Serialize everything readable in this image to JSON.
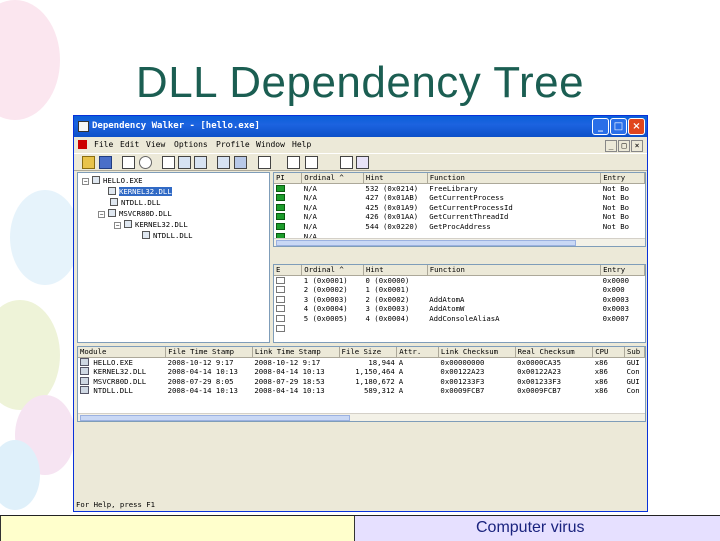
{
  "slide": {
    "title": "DLL Dependency Tree",
    "footer": "Computer virus"
  },
  "window": {
    "title": "Dependency Walker - [hello.exe]",
    "controls": {
      "minimize": "_",
      "maximize": "□",
      "close": "×"
    },
    "mdi_controls": [
      "_",
      "□",
      "×"
    ],
    "menu": [
      "File",
      "Edit",
      "View",
      "Options",
      "Profile",
      "Window",
      "Help"
    ]
  },
  "toolbar": {
    "icons": [
      "open-icon",
      "save-icon",
      "copy-icon",
      "find-icon",
      "full-paths-icon",
      "undecorate-icon",
      "configure-icon",
      "view-module-icon",
      "refresh-icon",
      "expand-all-icon",
      "collapse-all-icon",
      "system-info-icon",
      "properties-icon",
      "help-icon"
    ]
  },
  "tree": [
    {
      "label": "HELLO.EXE",
      "expander": "−"
    },
    {
      "label": "KERNEL32.DLL",
      "selected": true,
      "expander": ""
    },
    {
      "label": "NTDLL.DLL",
      "expander": ""
    },
    {
      "label": "MSVCR80D.DLL",
      "expander": "−"
    },
    {
      "label": "KERNEL32.DLL",
      "expander": "−"
    },
    {
      "label": "NTDLL.DLL",
      "expander": ""
    }
  ],
  "imports": {
    "columns": [
      "PI",
      "Ordinal ^",
      "Hint",
      "Function",
      "Entry"
    ],
    "rows": [
      [
        "",
        "N/A",
        "532 (0x0214)",
        "FreeLibrary",
        "Not Bo"
      ],
      [
        "",
        "N/A",
        "427 (0x01AB)",
        "GetCurrentProcess",
        "Not Bo"
      ],
      [
        "",
        "N/A",
        "425 (0x01A9)",
        "GetCurrentProcessId",
        "Not Bo"
      ],
      [
        "",
        "N/A",
        "426 (0x01AA)",
        "GetCurrentThreadId",
        "Not Bo"
      ],
      [
        "",
        "N/A",
        "544 (0x0220)",
        "GetProcAddress",
        "Not Bo"
      ],
      [
        "",
        "N/A",
        "",
        "",
        ""
      ]
    ]
  },
  "exports": {
    "columns": [
      "E",
      "Ordinal ^",
      "Hint",
      "Function",
      "Entry"
    ],
    "rows": [
      [
        "",
        "1 (0x0001)",
        "0 (0x0000)",
        "",
        "0x0000"
      ],
      [
        "",
        "2 (0x0002)",
        "1 (0x0001)",
        "",
        "0x000"
      ],
      [
        "",
        "3 (0x0003)",
        "2 (0x0002)",
        "AddAtomA",
        "0x0003"
      ],
      [
        "",
        "4 (0x0004)",
        "3 (0x0003)",
        "AddAtomW",
        "0x0003"
      ],
      [
        "",
        "5 (0x0005)",
        "4 (0x0004)",
        "AddConsoleAliasA",
        "0x0007"
      ],
      [
        "",
        "",
        "",
        "",
        ""
      ]
    ]
  },
  "modules": {
    "columns": [
      "Module",
      "File Time Stamp",
      "Link Time Stamp",
      "File Size",
      "Attr.",
      "Link Checksum",
      "Real Checksum",
      "CPU",
      "Sub"
    ],
    "rows": [
      [
        "HELLO.EXE",
        "2008-10-12  9:17",
        "2008-10-12  9:17",
        "18,944",
        "A",
        "0x00000000",
        "0x0000CA35",
        "x86",
        "GUI"
      ],
      [
        "KERNEL32.DLL",
        "2008-04-14 10:13",
        "2008-04-14 10:13",
        "1,150,464",
        "A",
        "0x00122A23",
        "0x00122A23",
        "x86",
        "Con"
      ],
      [
        "MSVCR80D.DLL",
        "2008-07-29  8:05",
        "2008-07-29 18:53",
        "1,180,672",
        "A",
        "0x001233F3",
        "0x001233F3",
        "x86",
        "GUI"
      ],
      [
        "NTDLL.DLL",
        "2008-04-14 10:13",
        "2008-04-14 10:13",
        "589,312",
        "A",
        "0x0009FCB7",
        "0x0009FCB7",
        "x86",
        "Con"
      ]
    ]
  },
  "status": "For Help, press F1"
}
